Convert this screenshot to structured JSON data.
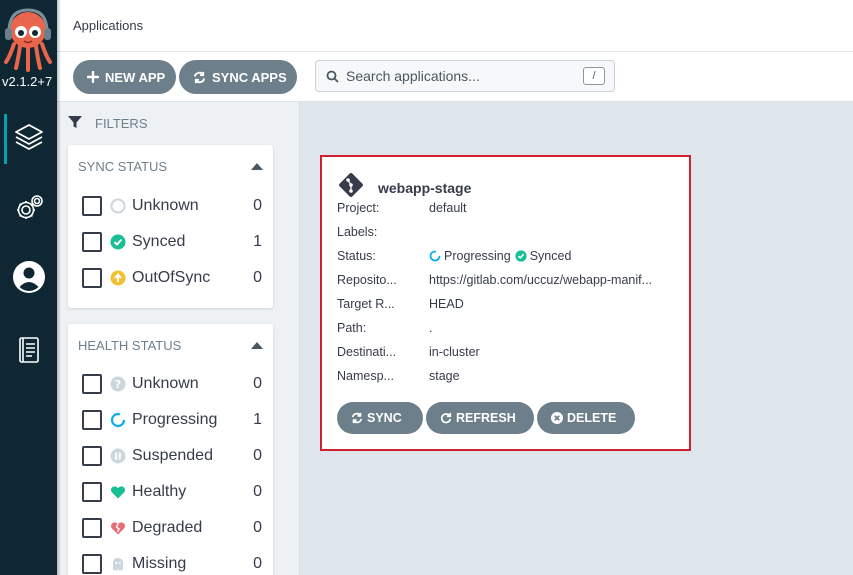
{
  "nav": {
    "version": "v2.1.2+7",
    "items": [
      {
        "name": "applications",
        "icon": "layers-icon",
        "active": true
      },
      {
        "name": "settings",
        "icon": "gear-icon",
        "active": false
      },
      {
        "name": "user-info",
        "icon": "user-icon",
        "active": false
      },
      {
        "name": "documentation",
        "icon": "book-icon",
        "active": false
      }
    ]
  },
  "header": {
    "title": "Applications"
  },
  "toolbar": {
    "new_app": "NEW APP",
    "sync_apps": "SYNC APPS",
    "search_placeholder": "Search applications...",
    "search_shortcut": "/"
  },
  "filters": {
    "title": "FILTERS",
    "sync_status": {
      "title": "SYNC STATUS",
      "items": [
        {
          "label": "Unknown",
          "count": "0",
          "icon": "circle-outline-icon"
        },
        {
          "label": "Synced",
          "count": "1",
          "icon": "check-circle-icon"
        },
        {
          "label": "OutOfSync",
          "count": "0",
          "icon": "arrow-up-circle-icon"
        }
      ]
    },
    "health_status": {
      "title": "HEALTH STATUS",
      "items": [
        {
          "label": "Unknown",
          "count": "0",
          "icon": "question-circle-icon"
        },
        {
          "label": "Progressing",
          "count": "1",
          "icon": "spinner-icon"
        },
        {
          "label": "Suspended",
          "count": "0",
          "icon": "pause-circle-icon"
        },
        {
          "label": "Healthy",
          "count": "0",
          "icon": "heart-icon"
        },
        {
          "label": "Degraded",
          "count": "0",
          "icon": "broken-heart-icon"
        },
        {
          "label": "Missing",
          "count": "0",
          "icon": "ghost-icon"
        }
      ]
    }
  },
  "app": {
    "name": "webapp-stage",
    "fields": [
      {
        "key": "Project:",
        "value": "default"
      },
      {
        "key": "Labels:",
        "value": ""
      },
      {
        "key": "Status:",
        "value": ""
      },
      {
        "key": "Reposito...",
        "value": "https://gitlab.com/uccuz/webapp-manif..."
      },
      {
        "key": "Target R...",
        "value": "HEAD"
      },
      {
        "key": "Path:",
        "value": "."
      },
      {
        "key": "Destinati...",
        "value": "in-cluster"
      },
      {
        "key": "Namesp...",
        "value": "stage"
      }
    ],
    "health": "Progressing",
    "sync": "Synced",
    "buttons": {
      "sync": "SYNC",
      "refresh": "REFRESH",
      "delete": "DELETE"
    }
  },
  "colors": {
    "nav_bg": "#0f2733",
    "button_bg": "#6d7f8b",
    "synced_green": "#18be94",
    "progressing_blue": "#0dadea",
    "outofsync_amber": "#f4c030",
    "degraded_red": "#e96d76",
    "highlight_red": "#d32030"
  }
}
